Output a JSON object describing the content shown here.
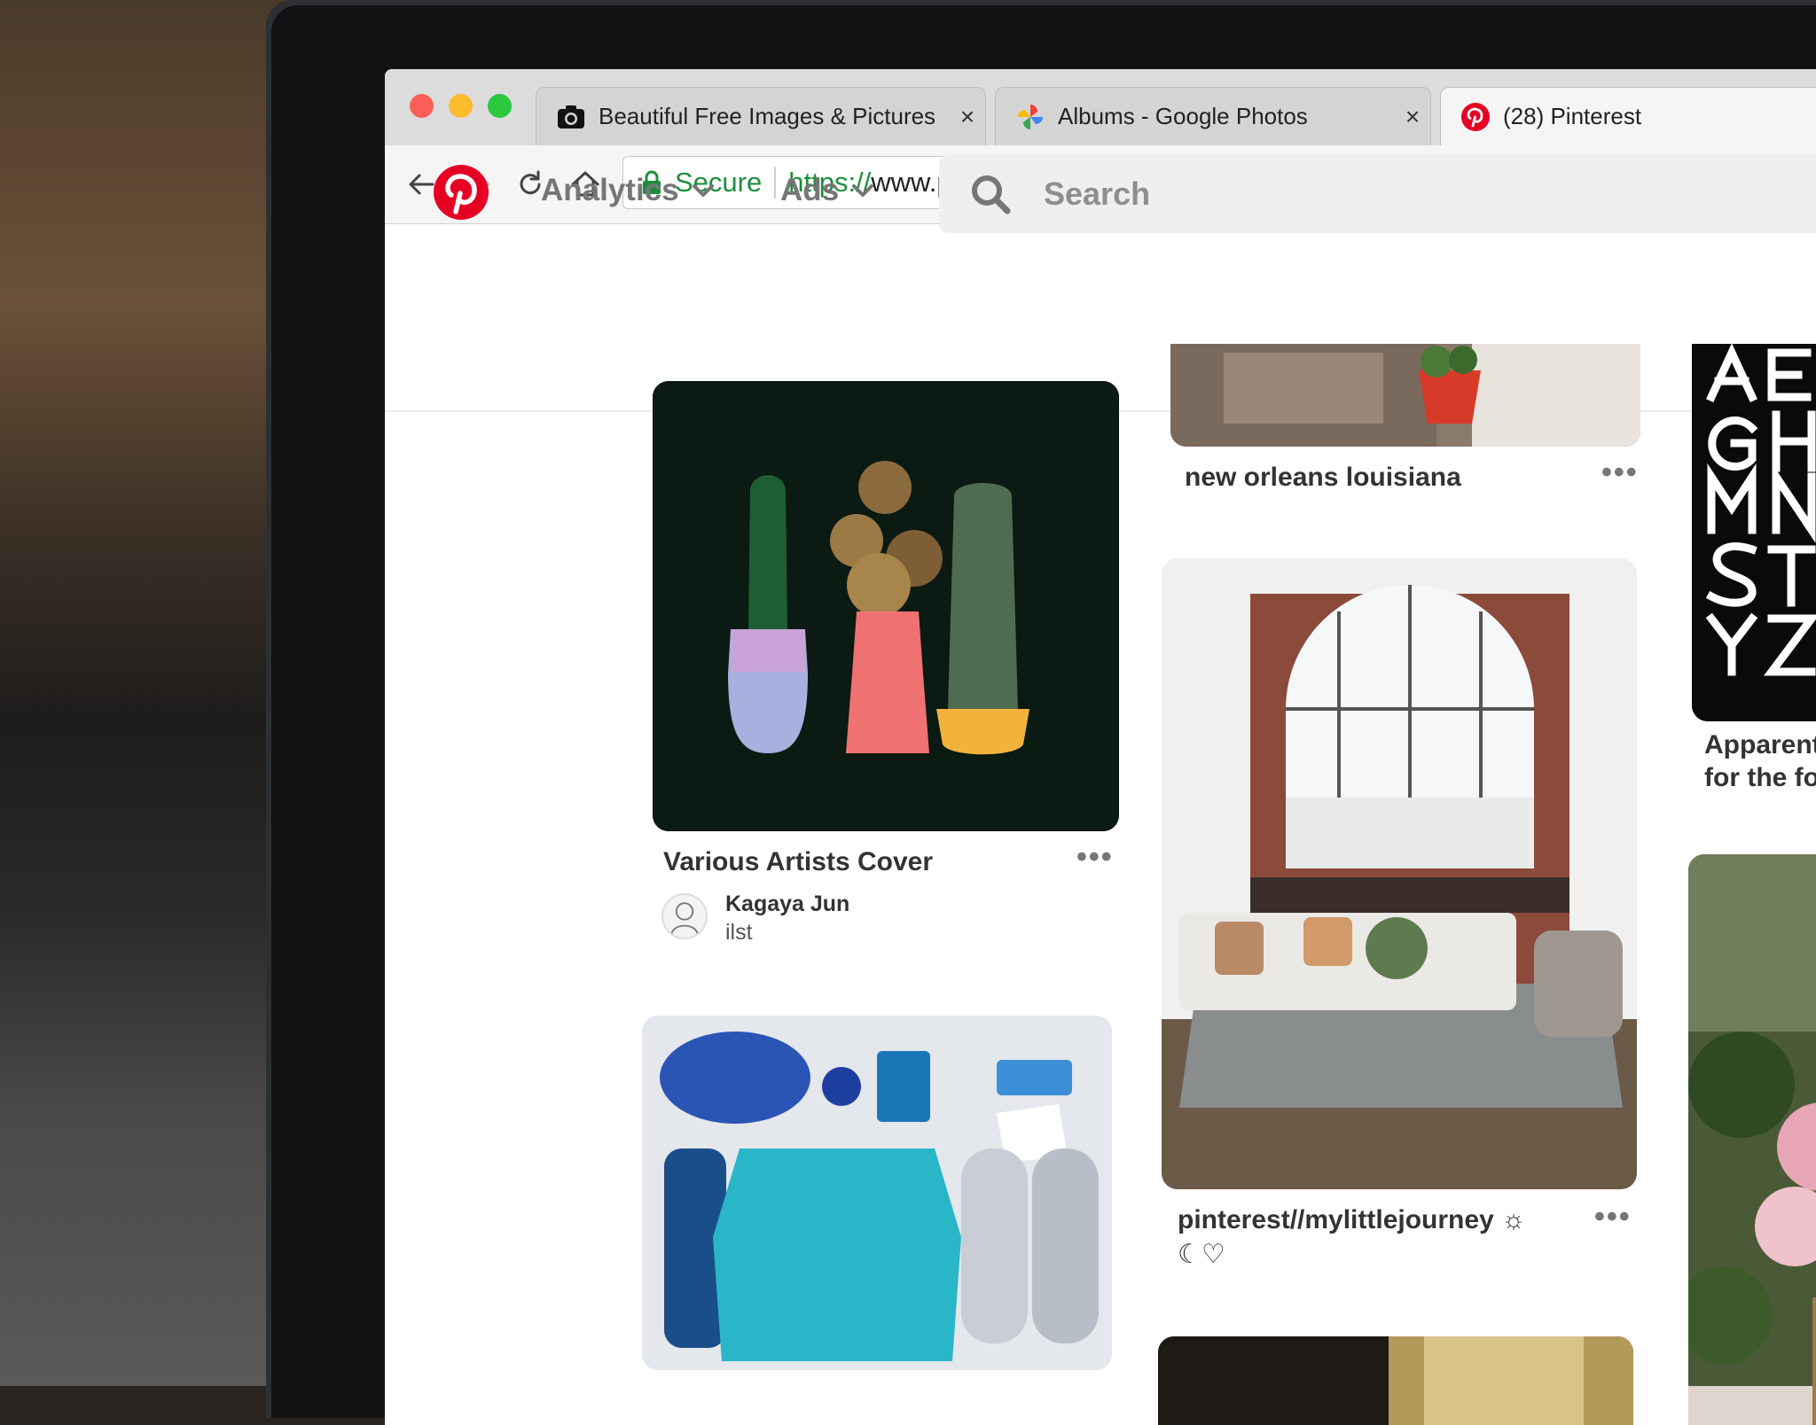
{
  "browser": {
    "tabs": [
      {
        "title": "Beautiful Free Images & Pictures",
        "icon": "camera-icon",
        "active": false,
        "close": "×"
      },
      {
        "title": "Albums - Google Photos",
        "icon": "google-photos-icon",
        "active": false,
        "close": "×"
      },
      {
        "title": "(28) Pinterest",
        "icon": "pinterest-icon",
        "active": true
      }
    ],
    "address": {
      "secure_label": "Secure",
      "scheme": "https://",
      "host": "www.pinterest.ca"
    }
  },
  "header": {
    "menus": [
      {
        "label": "Analytics",
        "icon": "chevron-down-icon"
      },
      {
        "label": "Ads",
        "icon": "chevron-down-icon"
      }
    ],
    "search": {
      "placeholder": "Search",
      "value": ""
    }
  },
  "pins": {
    "cactus": {
      "title": "Various Artists Cover",
      "more": "•••",
      "pinner_name": "Kagaya Jun",
      "pinner_board": "ilst"
    },
    "orleans": {
      "title": "new orleans louisiana",
      "more": "•••"
    },
    "room": {
      "title": "pinterest//mylittlejourney ☼",
      "subtitle": "☾♡",
      "more": "•••"
    },
    "typography": {
      "title": "Apparently for the fo"
    }
  },
  "colors": {
    "pinterest_red": "#e60023",
    "secure_green": "#1e8e3e",
    "muted_text": "#767676",
    "search_bg": "#efefef"
  }
}
